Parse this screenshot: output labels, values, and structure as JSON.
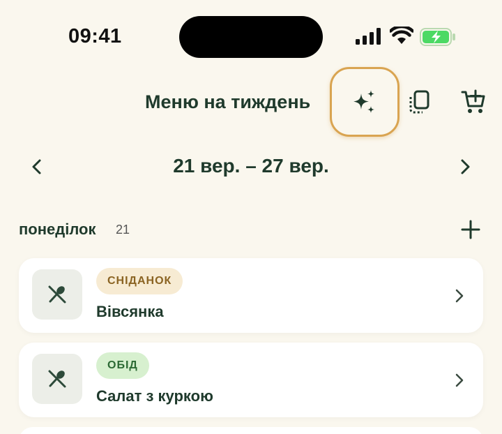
{
  "status_bar": {
    "time": "09:41",
    "signal_icon": "cellular-signal-icon",
    "wifi_icon": "wifi-icon",
    "battery_icon": "battery-charging-icon",
    "battery_color": "#4cd964"
  },
  "header": {
    "title": "Меню на тиждень",
    "actions": [
      "sparkles-icon",
      "copy-week-icon",
      "add-to-cart-icon"
    ],
    "highlight_color": "#d9a451"
  },
  "week": {
    "range": "21 вер. – 27 вер."
  },
  "day": {
    "name": "понеділок",
    "number": "21"
  },
  "meals": [
    {
      "type": "СНІДАНОК",
      "title": "Вівсянка",
      "icon": "utensils-icon"
    },
    {
      "type": "ОБІД",
      "title": "Салат з куркою",
      "icon": "utensils-icon"
    }
  ],
  "colors": {
    "background": "#faf7ee",
    "text": "#1f3a2c",
    "breakfast_badge": "#f7ebd3",
    "lunch_badge": "#d7f0cf"
  }
}
